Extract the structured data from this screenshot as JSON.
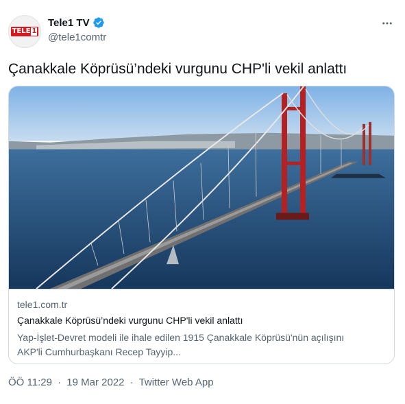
{
  "author": {
    "display_name": "Tele1 TV",
    "handle": "@tele1comtr",
    "logo_text": "TELE",
    "logo_num": "1",
    "verified_icon": "verified-badge-icon",
    "brand_color": "#d71920",
    "verified_color": "#1d9bf0"
  },
  "tweet": {
    "text": "Çanakkale Köprüsü’ndeki vurgunu CHP'li vekil anlattı"
  },
  "card": {
    "domain": "tele1.com.tr",
    "title": "Çanakkale Köprüsü’ndeki vurgunu CHP'li vekil anlattı",
    "description_line1": "Yap-İşlet-Devret modeli ile ihale edilen 1915 Çanakkale Köprüsü'nün açılışını",
    "description_line2": "AKP'li Cumhurbaşkanı Recep Tayyip...",
    "image_icon": "suspension-bridge-photo"
  },
  "meta": {
    "time": "ÖÖ 11:29",
    "date": "19 Mar 2022",
    "source": "Twitter Web App",
    "separator": "·"
  },
  "menu": {
    "icon": "more-options-icon"
  },
  "colors": {
    "text_primary": "#0f1419",
    "text_secondary": "#536471",
    "border": "#cfd9de"
  }
}
